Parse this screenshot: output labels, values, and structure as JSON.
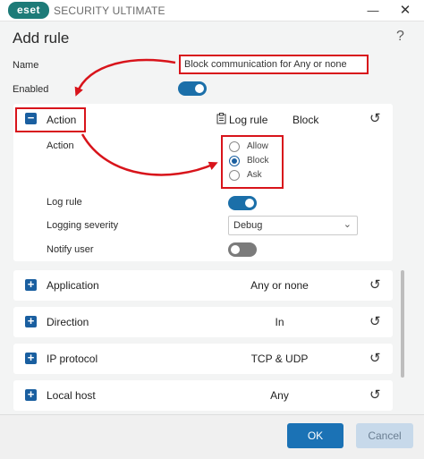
{
  "window": {
    "logo_text": "eset",
    "app_title": "SECURITY ULTIMATE",
    "minimize_glyph": "—",
    "close_glyph": "✕"
  },
  "dialog": {
    "title": "Add rule",
    "help_glyph": "?"
  },
  "form": {
    "name_label": "Name",
    "name_value": "Block communication for Any or none",
    "enabled_label": "Enabled",
    "enabled": true
  },
  "action_section": {
    "expander_glyph": "−",
    "title": "Action",
    "log_icon_glyph": "📋",
    "log_label": "Log rule",
    "summary_value": "Block",
    "reset_glyph": "↺",
    "action_label": "Action",
    "options": [
      {
        "label": "Allow",
        "checked": false
      },
      {
        "label": "Block",
        "checked": true
      },
      {
        "label": "Ask",
        "checked": false
      }
    ],
    "log_rule_label": "Log rule",
    "log_rule_enabled": true,
    "logging_severity_label": "Logging severity",
    "logging_severity_value": "Debug",
    "notify_user_label": "Notify user",
    "notify_user_enabled": false
  },
  "sections": [
    {
      "expander_glyph": "+",
      "title": "Application",
      "value": "Any or none",
      "reset_glyph": "↺"
    },
    {
      "expander_glyph": "+",
      "title": "Direction",
      "value": "In",
      "reset_glyph": "↺"
    },
    {
      "expander_glyph": "+",
      "title": "IP protocol",
      "value": "TCP & UDP",
      "reset_glyph": "↺"
    },
    {
      "expander_glyph": "+",
      "title": "Local host",
      "value": "Any",
      "reset_glyph": "↺"
    }
  ],
  "footer": {
    "ok_label": "OK",
    "cancel_label": "Cancel"
  },
  "colors": {
    "accent": "#1b6fa9",
    "annotation_red": "#d8141b",
    "toggle_off": "#7b7b7b"
  }
}
